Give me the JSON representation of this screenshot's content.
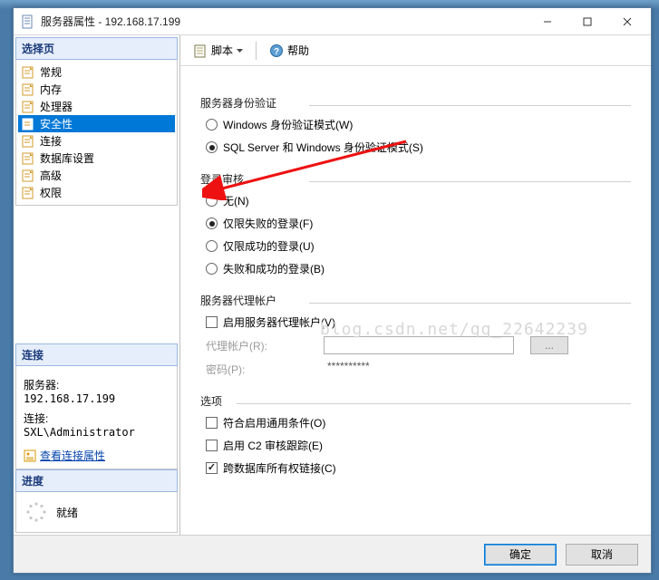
{
  "window": {
    "title": "服务器属性 - 192.168.17.199"
  },
  "left": {
    "select_page": "选择页",
    "pages": [
      "常规",
      "内存",
      "处理器",
      "安全性",
      "连接",
      "数据库设置",
      "高级",
      "权限"
    ],
    "selected_index": 3,
    "connection_header": "连接",
    "server_label": "服务器:",
    "server_value": "192.168.17.199",
    "conn_label": "连接:",
    "conn_value": "SXL\\Administrator",
    "view_props": "查看连接属性",
    "progress_header": "进度",
    "progress_text": "就绪"
  },
  "toolbar": {
    "script": "脚本",
    "help": "帮助"
  },
  "content": {
    "auth_header": "服务器身份验证",
    "auth_windows": "Windows 身份验证模式(W)",
    "auth_mixed": "SQL Server 和 Windows 身份验证模式(S)",
    "audit_header": "登录审核",
    "audit_none": "无(N)",
    "audit_failed": "仅限失败的登录(F)",
    "audit_success": "仅限成功的登录(U)",
    "audit_both": "失败和成功的登录(B)",
    "proxy_header": "服务器代理帐户",
    "proxy_enable": "启用服务器代理帐户(V)",
    "proxy_account_label": "代理帐户(R):",
    "proxy_password_label": "密码(P):",
    "proxy_password_value": "**********",
    "proxy_browse": "...",
    "options_header": "选项",
    "opt_common": "符合启用通用条件(O)",
    "opt_c2": "启用 C2 审核跟踪(E)",
    "opt_crossdb": "跨数据库所有权链接(C)"
  },
  "watermark": "blog.csdn.net/qq_22642239",
  "buttons": {
    "ok": "确定",
    "cancel": "取消"
  }
}
